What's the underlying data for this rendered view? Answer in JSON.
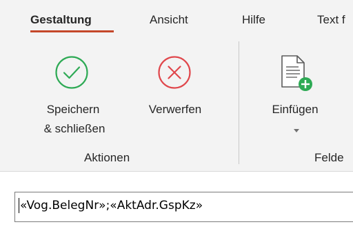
{
  "ribbon": {
    "tabs": [
      {
        "label": "Gestaltung",
        "active": true
      },
      {
        "label": "Ansicht",
        "active": false
      },
      {
        "label": "Hilfe",
        "active": false
      },
      {
        "label": "Text f",
        "active": false
      }
    ],
    "groups": {
      "aktionen": {
        "label": "Aktionen",
        "commands": {
          "save": {
            "line1": "Speichern",
            "line2": "& schließen",
            "icon": "check-circle-icon"
          },
          "discard": {
            "line1": "Verwerfen",
            "icon": "x-circle-icon"
          }
        }
      },
      "felder": {
        "label": "Felde",
        "commands": {
          "insert": {
            "line1": "Einfügen",
            "icon": "insert-document-icon"
          }
        }
      }
    },
    "colors": {
      "accent_underline": "#c4472a",
      "save_green": "#2eaa55",
      "discard_red": "#e0474c",
      "ribbon_bg": "#f3f3f3"
    }
  },
  "editor": {
    "value": "«Vog.BelegNr»;«AktAdr.GspKz»"
  }
}
